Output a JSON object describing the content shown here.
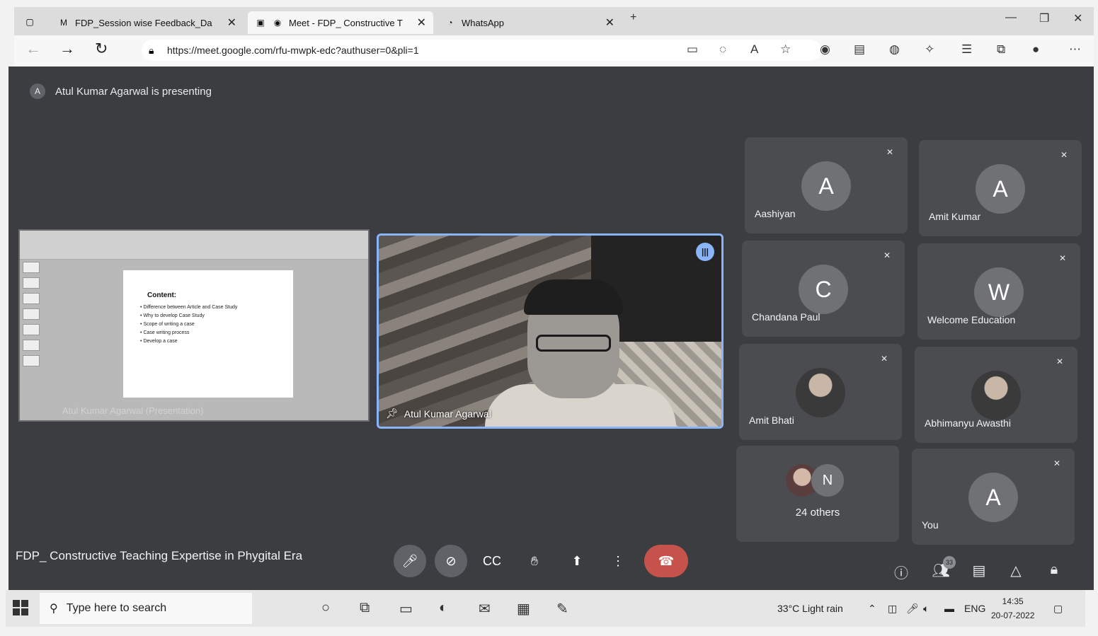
{
  "browser": {
    "tabs": [
      {
        "icon": "gmail-icon",
        "title": "FDP_Session wise Feedback_Da"
      },
      {
        "icon": "meet-icon",
        "title": "Meet - FDP_ Constructive T"
      },
      {
        "icon": "whatsapp-icon",
        "title": "WhatsApp"
      }
    ],
    "new_tab": "+",
    "url": "https://meet.google.com/rfu-mwpk-edc?authuser=0&pli=1"
  },
  "meet": {
    "presenting_badge": "A",
    "presenting_text": "Atul Kumar Agarwal is presenting",
    "slide": {
      "title": "Content:",
      "bullets": [
        "Difference between Article and Case Study",
        "Why to develop Case Study",
        "Scope of writing a case",
        "Case writing process",
        "Develop a case"
      ],
      "caption": "Atul Kumar Agarwal (Presentation)"
    },
    "presenter_name": "Atul Kumar Agarwal",
    "participants": [
      {
        "initial": "A",
        "name": "Aashiyan"
      },
      {
        "initial": "A",
        "name": "Amit Kumar"
      },
      {
        "initial": "C",
        "name": "Chandana Paul"
      },
      {
        "initial": "W",
        "name": "Welcome Education"
      },
      {
        "initial": "",
        "name": "Amit Bhati"
      },
      {
        "initial": "",
        "name": "Abhimanyu Awasthi"
      }
    ],
    "others": {
      "initial": "N",
      "count_label": "24 others"
    },
    "you": {
      "initial": "A",
      "name": "You"
    },
    "meeting_title": "FDP_ Constructive Teaching Expertise in Phygital Era",
    "people_count": "33"
  },
  "taskbar": {
    "search_placeholder": "Type here to search",
    "weather": "33°C  Light rain",
    "language": "ENG",
    "time": "14:35",
    "date": "20-07-2022"
  }
}
